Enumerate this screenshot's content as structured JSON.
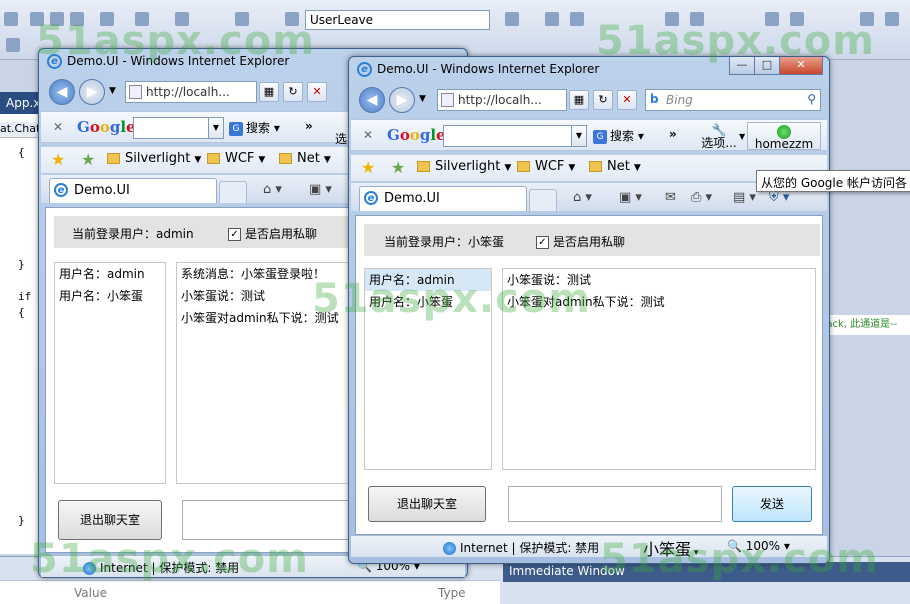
{
  "vs": {
    "combo_value": "UserLeave",
    "tab_label": "App.x",
    "class_label": "at.Chat",
    "code_lines": [
      "{",
      "}",
      "if",
      "{",
      "}"
    ],
    "right_code": "back, 此通道是--",
    "immediate_window": "Immediate Window",
    "props_value": "Value",
    "props_type": "Type"
  },
  "win1": {
    "title": "Demo.UI - Windows Internet Explorer",
    "address": "http://localh...",
    "google_search": "搜索",
    "google_options": "选",
    "fav_silverlight": "Silverlight",
    "fav_wcf": "WCF",
    "fav_net": "Net",
    "tab_label": "Demo.UI",
    "current_user": "当前登录用户：admin",
    "private_chat": "是否启用私聊",
    "users": [
      "用户名：admin",
      "用户名：小笨蛋"
    ],
    "messages": [
      "系统消息：小笨蛋登录啦！",
      "小笨蛋说：测试",
      "小笨蛋对admin私下说：测试"
    ],
    "exit_button": "退出聊天室",
    "status_zone": "Internet | 保护模式: 禁用",
    "status_zoom": "100%"
  },
  "win2": {
    "title": "Demo.UI - Windows Internet Explorer",
    "address": "http://localh...",
    "search_engine": "Bing",
    "google_search": "搜索",
    "google_options": "选项...",
    "google_account": "homezzm",
    "fav_silverlight": "Silverlight",
    "fav_wcf": "WCF",
    "fav_net": "Net",
    "tab_label": "Demo.UI",
    "current_user": "当前登录用户：小笨蛋",
    "private_chat": "是否启用私聊",
    "users": [
      "用户名：admin",
      "用户名：小笨蛋"
    ],
    "messages": [
      "小笨蛋说：测试",
      "小笨蛋对admin私下说：测试"
    ],
    "exit_button": "退出聊天室",
    "send_button": "发送",
    "status_zone": "Internet | 保护模式: 禁用",
    "status_user": "小笨蛋",
    "status_zoom": "100%"
  },
  "tooltip": "从您的 Google 帐户访问各",
  "watermark": "51aspx.com"
}
